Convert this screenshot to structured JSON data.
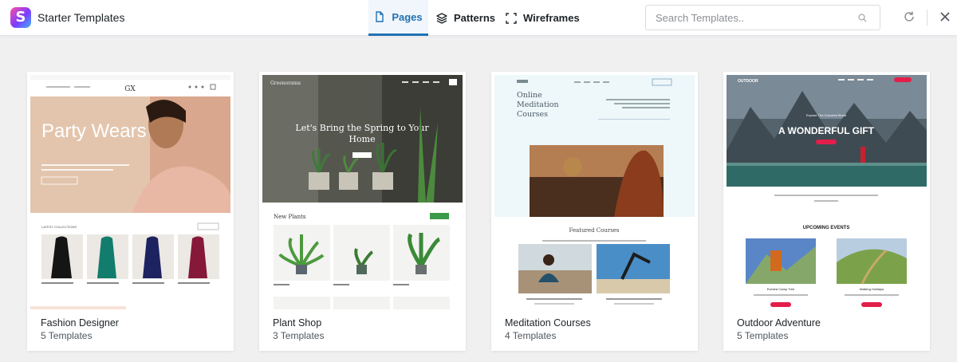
{
  "app": {
    "title": "Starter Templates",
    "logo_letter": "S"
  },
  "tabs": [
    {
      "label": "Pages",
      "icon": "page-icon",
      "active": true
    },
    {
      "label": "Patterns",
      "icon": "layers-icon",
      "active": false
    },
    {
      "label": "Wireframes",
      "icon": "wireframe-icon",
      "active": false
    }
  ],
  "search": {
    "placeholder": "Search Templates..",
    "value": ""
  },
  "colors": {
    "accent": "#2271b1",
    "background": "#f0f0f1"
  },
  "cards": [
    {
      "name": "Fashion Designer",
      "count": "5 Templates",
      "preview": {
        "logo": "GX",
        "hero": "Party Wears",
        "section": "LATEST COLLECTIONS"
      }
    },
    {
      "name": "Plant Shop",
      "count": "3 Templates",
      "preview": {
        "logo": "Greenorama",
        "hero": "Let's Bring the Spring to Your Home",
        "section": "New Plants"
      }
    },
    {
      "name": "Meditation Courses",
      "count": "4 Templates",
      "preview": {
        "hero": "Online Meditation Courses",
        "section": "Featured Courses"
      }
    },
    {
      "name": "Outdoor Adventure",
      "count": "5 Templates",
      "preview": {
        "logo": "OUTDOOR",
        "tagline": "Explore The Colourful World",
        "hero": "A WONDERFUL GIFT",
        "section": "UPCOMING EVENTS",
        "event_1": "Everest Camp Trek",
        "event_2": "Walking Holidays"
      }
    }
  ]
}
